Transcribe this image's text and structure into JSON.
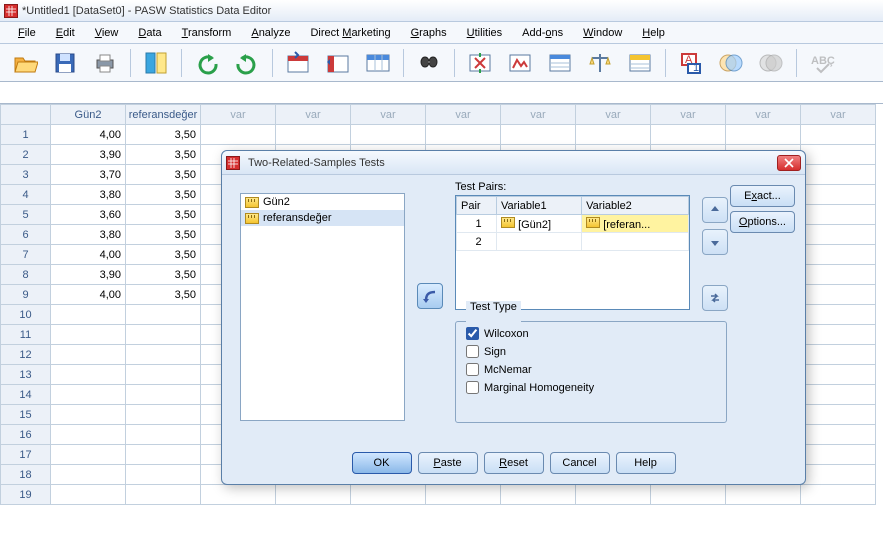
{
  "title": "*Untitled1 [DataSet0] - PASW Statistics Data Editor",
  "menu": {
    "file": "File",
    "edit": "Edit",
    "view": "View",
    "data": "Data",
    "transform": "Transform",
    "analyze": "Analyze",
    "direct": "Direct Marketing",
    "graphs": "Graphs",
    "utilities": "Utilities",
    "addons": "Add-ons",
    "window": "Window",
    "help": "Help"
  },
  "columns": [
    "Gün2",
    "referansdeğer",
    "var",
    "var",
    "var",
    "var",
    "var",
    "var",
    "var",
    "var",
    "var"
  ],
  "rows": [
    {
      "n": "1",
      "c1": "4,00",
      "c2": "3,50"
    },
    {
      "n": "2",
      "c1": "3,90",
      "c2": "3,50"
    },
    {
      "n": "3",
      "c1": "3,70",
      "c2": "3,50"
    },
    {
      "n": "4",
      "c1": "3,80",
      "c2": "3,50"
    },
    {
      "n": "5",
      "c1": "3,60",
      "c2": "3,50"
    },
    {
      "n": "6",
      "c1": "3,80",
      "c2": "3,50"
    },
    {
      "n": "7",
      "c1": "4,00",
      "c2": "3,50"
    },
    {
      "n": "8",
      "c1": "3,90",
      "c2": "3,50"
    },
    {
      "n": "9",
      "c1": "4,00",
      "c2": "3,50"
    },
    {
      "n": "10"
    },
    {
      "n": "11"
    },
    {
      "n": "12"
    },
    {
      "n": "13"
    },
    {
      "n": "14"
    },
    {
      "n": "15"
    },
    {
      "n": "16"
    },
    {
      "n": "17"
    },
    {
      "n": "18"
    },
    {
      "n": "19"
    }
  ],
  "dialog": {
    "title": "Two-Related-Samples Tests",
    "source": {
      "items": [
        "Gün2",
        "referansdeğer"
      ],
      "selected": 1
    },
    "pairs_label": "Test Pairs:",
    "pairs_headers": {
      "pair": "Pair",
      "v1": "Variable1",
      "v2": "Variable2"
    },
    "pairs": [
      {
        "pair": "1",
        "v1": "[Gün2]",
        "v2": "[referan..."
      },
      {
        "pair": "2",
        "v1": "",
        "v2": ""
      }
    ],
    "buttons": {
      "exact": "Exact...",
      "options": "Options...",
      "ok": "OK",
      "paste": "Paste",
      "reset": "Reset",
      "cancel": "Cancel",
      "help": "Help"
    },
    "test_type": {
      "legend": "Test Type",
      "wilcoxon": "Wilcoxon",
      "sign": "Sign",
      "mcnemar": "McNemar",
      "marginal": "Marginal Homogeneity",
      "checked": {
        "wilcoxon": true,
        "sign": false,
        "mcnemar": false,
        "marginal": false
      }
    }
  }
}
